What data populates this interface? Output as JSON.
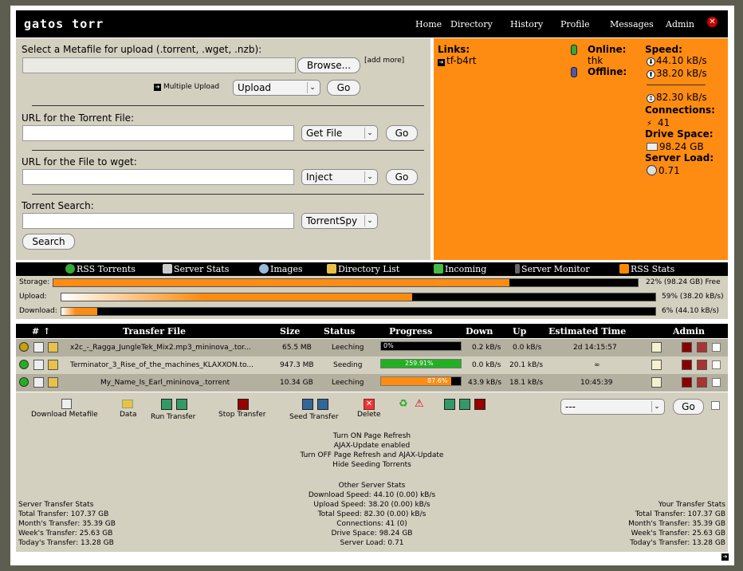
{
  "header": {
    "brand": "gatos torr",
    "nav": [
      "Home",
      "Directory",
      "History",
      "Profile",
      "Messages",
      "Admin"
    ]
  },
  "upload": {
    "label": "Select a Metafile for upload (.torrent, .wget, .nzb):",
    "browse": "Browse...",
    "add_more": "[add more]",
    "multiple": "Multiple Upload",
    "action_select": "Upload",
    "go": "Go"
  },
  "url_torrent": {
    "label": "URL for the Torrent File:",
    "select": "Get File",
    "go": "Go"
  },
  "url_wget": {
    "label": "URL for the File to wget:",
    "select": "Inject",
    "go": "Go"
  },
  "search": {
    "label": "Torrent Search:",
    "select": "TorrentSpy",
    "button": "Search"
  },
  "status": {
    "links_label": "Links:",
    "link": "tf-b4rt",
    "online_label": "Online:",
    "online_user": "thk",
    "offline_label": "Offline:",
    "speed_label": "Speed:",
    "down_speed": "44.10 kB/s",
    "up_speed": "38.20 kB/s",
    "total_speed": "82.30 kB/s",
    "connections_label": "Connections:",
    "connections": "41",
    "drive_label": "Drive Space:",
    "drive": "98.24 GB",
    "load_label": "Server Load:",
    "load": "0.71"
  },
  "iconbar": [
    "RSS Torrents",
    "Server Stats",
    "Images",
    "Directory List",
    "Incoming",
    "Server Monitor",
    "RSS Stats"
  ],
  "meters": {
    "storage": {
      "label": "Storage:",
      "fraction": 0.78,
      "text": "22% (98.24 GB) Free",
      "color": "#ff8c12"
    },
    "upload": {
      "label": "Upload:",
      "fraction": 0.59,
      "text": "59% (38.20 kB/s)",
      "color": "#ff8c12"
    },
    "download": {
      "label": "Download:",
      "fraction": 0.06,
      "text": "6% (44.10 kB/s)",
      "color": "#ff8c12"
    }
  },
  "table": {
    "headers": {
      "num": "#",
      "sort": "↑",
      "file": "Transfer File",
      "size": "Size",
      "status": "Status",
      "progress": "Progress",
      "down": "Down",
      "up": "Up",
      "eta": "Estimated Time",
      "admin": "Admin"
    },
    "rows": [
      {
        "file": "x2c_-_Ragga_JungleTek_Mix2.mp3_mininova_.tor...",
        "size": "65.5 MB",
        "status": "Leeching",
        "progress_text": "0%",
        "progress": 0.0,
        "bar_color": "#ff8c12",
        "down": "0.2 kB/s",
        "up": "0.0 kB/s",
        "eta": "2d 14:15:57",
        "dot": "#c8a000"
      },
      {
        "file": "Terminator_3_Rise_of_the_machines_KLAXXON.to...",
        "size": "947.3 MB",
        "status": "Seeding",
        "progress_text": "259.91%",
        "progress": 1.0,
        "bar_color": "#22b022",
        "down": "0.0 kB/s",
        "up": "20.1 kB/s",
        "eta": "∞",
        "dot": "#22b022"
      },
      {
        "file": "My_Name_Is_Earl_mininova_.torrent",
        "size": "10.34 GB",
        "status": "Leeching",
        "progress_text": "87.6%",
        "progress": 0.876,
        "bar_color": "#ff8c12",
        "down": "43.9 kB/s",
        "up": "18.1 kB/s",
        "eta": "10:45:39",
        "dot": "#22b022"
      }
    ]
  },
  "actions": {
    "download_metafile": "Download Metafile",
    "data": "Data",
    "run": "Run Transfer",
    "stop": "Stop Transfer",
    "seed": "Seed Transfer",
    "delete": "Delete",
    "bulk_select": "---",
    "go": "Go"
  },
  "refresh": {
    "line1": "Turn ON Page Refresh",
    "line2": "AJAX-Update enabled",
    "line3": "Turn OFF Page Refresh and AJAX-Update",
    "line4": "Hide Seeding Torrents"
  },
  "other_stats": {
    "title": "Other Server Stats",
    "download": "Download Speed: 44.10 (0.00) kB/s",
    "upload": "Upload Speed: 38.20 (0.00) kB/s",
    "total": "Total Speed: 82.30 (0.00) kB/s",
    "connections": "Connections: 41 (0)",
    "drive": "Drive Space: 98.24 GB",
    "load": "Server Load: 0.71"
  },
  "server_transfer": {
    "title": "Server Transfer Stats",
    "total": "Total Transfer: 107.37 GB",
    "month": "Month's Transfer: 35.39 GB",
    "week": "Week's Transfer: 25.63 GB",
    "today": "Today's Transfer: 13.28 GB"
  },
  "your_transfer": {
    "title": "Your Transfer Stats",
    "total": "Total Transfer: 107.37 GB",
    "month": "Month's Transfer: 35.39 GB",
    "week": "Week's Transfer: 25.63 GB",
    "today": "Today's Transfer: 13.28 GB"
  }
}
